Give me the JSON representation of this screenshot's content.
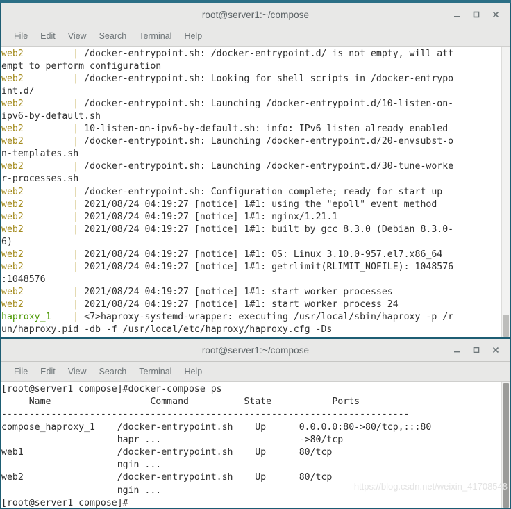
{
  "desktop": {
    "background_color": "#2b6f86"
  },
  "windows": [
    {
      "id": "top",
      "title": "root@server1:~/compose",
      "menu": [
        "File",
        "Edit",
        "View",
        "Search",
        "Terminal",
        "Help"
      ],
      "buttons": {
        "minimize": "minimize-icon",
        "maximize": "maximize-icon",
        "close": "close-icon"
      },
      "terminal_lines": [
        {
          "label": "web2",
          "label_color": "#a38a1c",
          "pipe": "|",
          "text": " /docker-entrypoint.sh: /docker-entrypoint.d/ is not empty, will att"
        },
        {
          "label": "",
          "pipe": "",
          "text": "empt to perform configuration"
        },
        {
          "label": "web2",
          "label_color": "#a38a1c",
          "pipe": "|",
          "text": " /docker-entrypoint.sh: Looking for shell scripts in /docker-entrypo"
        },
        {
          "label": "",
          "pipe": "",
          "text": "int.d/"
        },
        {
          "label": "web2",
          "label_color": "#a38a1c",
          "pipe": "|",
          "text": " /docker-entrypoint.sh: Launching /docker-entrypoint.d/10-listen-on-"
        },
        {
          "label": "",
          "pipe": "",
          "text": "ipv6-by-default.sh"
        },
        {
          "label": "web2",
          "label_color": "#a38a1c",
          "pipe": "|",
          "text": " 10-listen-on-ipv6-by-default.sh: info: IPv6 listen already enabled"
        },
        {
          "label": "web2",
          "label_color": "#a38a1c",
          "pipe": "|",
          "text": " /docker-entrypoint.sh: Launching /docker-entrypoint.d/20-envsubst-o"
        },
        {
          "label": "",
          "pipe": "",
          "text": "n-templates.sh"
        },
        {
          "label": "web2",
          "label_color": "#a38a1c",
          "pipe": "|",
          "text": " /docker-entrypoint.sh: Launching /docker-entrypoint.d/30-tune-worke"
        },
        {
          "label": "",
          "pipe": "",
          "text": "r-processes.sh"
        },
        {
          "label": "web2",
          "label_color": "#a38a1c",
          "pipe": "|",
          "text": " /docker-entrypoint.sh: Configuration complete; ready for start up"
        },
        {
          "label": "web2",
          "label_color": "#a38a1c",
          "pipe": "|",
          "text": " 2021/08/24 04:19:27 [notice] 1#1: using the \"epoll\" event method"
        },
        {
          "label": "web2",
          "label_color": "#a38a1c",
          "pipe": "|",
          "text": " 2021/08/24 04:19:27 [notice] 1#1: nginx/1.21.1"
        },
        {
          "label": "web2",
          "label_color": "#a38a1c",
          "pipe": "|",
          "text": " 2021/08/24 04:19:27 [notice] 1#1: built by gcc 8.3.0 (Debian 8.3.0-"
        },
        {
          "label": "",
          "pipe": "",
          "text": "6)"
        },
        {
          "label": "web2",
          "label_color": "#a38a1c",
          "pipe": "|",
          "text": " 2021/08/24 04:19:27 [notice] 1#1: OS: Linux 3.10.0-957.el7.x86_64"
        },
        {
          "label": "web2",
          "label_color": "#a38a1c",
          "pipe": "|",
          "text": " 2021/08/24 04:19:27 [notice] 1#1: getrlimit(RLIMIT_NOFILE): 1048576"
        },
        {
          "label": "",
          "pipe": "",
          "text": ":1048576"
        },
        {
          "label": "web2",
          "label_color": "#a38a1c",
          "pipe": "|",
          "text": " 2021/08/24 04:19:27 [notice] 1#1: start worker processes"
        },
        {
          "label": "web2",
          "label_color": "#a38a1c",
          "pipe": "|",
          "text": " 2021/08/24 04:19:27 [notice] 1#1: start worker process 24"
        },
        {
          "label": "haproxy_1",
          "label_color": "#4e9a06",
          "pipe": "|",
          "text": " <7>haproxy-systemd-wrapper: executing /usr/local/sbin/haproxy -p /r"
        },
        {
          "label": "",
          "pipe": "",
          "text": "un/haproxy.pid -db -f /usr/local/etc/haproxy/haproxy.cfg -Ds"
        }
      ]
    },
    {
      "id": "bottom",
      "title": "root@server1:~/compose",
      "menu": [
        "File",
        "Edit",
        "View",
        "Search",
        "Terminal",
        "Help"
      ],
      "buttons": {
        "minimize": "minimize-icon",
        "maximize": "maximize-icon",
        "close": "close-icon"
      },
      "prompt": "[root@server1 compose]#",
      "command": "docker-compose ps",
      "ps_table": {
        "headers": [
          "Name",
          "Command",
          "State",
          "Ports"
        ],
        "separator": "--------------------------------------------------------------------",
        "rows": [
          {
            "name": "compose_haproxy_1",
            "command": "/docker-entrypoint.sh",
            "command_cont": "hapr ...",
            "state": "Up",
            "ports": "0.0.0.0:80->80/tcp,:::80",
            "ports_cont": "->80/tcp"
          },
          {
            "name": "web1",
            "command": "/docker-entrypoint.sh",
            "command_cont": "ngin ...",
            "state": "Up",
            "ports": "80/tcp",
            "ports_cont": ""
          },
          {
            "name": "web2",
            "command": "/docker-entrypoint.sh",
            "command_cont": "ngin ...",
            "state": "Up",
            "ports": "80/tcp",
            "ports_cont": ""
          }
        ]
      },
      "terminal_lines": [
        "[root@server1 compose]#docker-compose ps",
        "     Name                  Command          State           Ports           ",
        "--------------------------------------------------------------------------",
        "compose_haproxy_1    /docker-entrypoint.sh    Up      0.0.0.0:80->80/tcp,:::80",
        "                     hapr ...                         ->80/tcp",
        "web1                 /docker-entrypoint.sh    Up      80/tcp",
        "                     ngin ...",
        "web2                 /docker-entrypoint.sh    Up      80/tcp",
        "                     ngin ...",
        "[root@server1 compose]#"
      ]
    }
  ],
  "watermark": "https://blog.csdn.net/weixin_41708548"
}
